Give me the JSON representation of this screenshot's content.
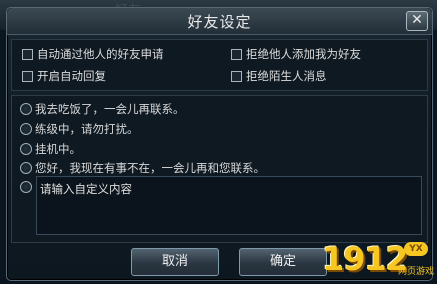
{
  "background": {
    "ghost_text": "好友"
  },
  "dialog": {
    "title": "好友设定",
    "close_label": "✕"
  },
  "options": [
    {
      "label": "自动通过他人的好友申请",
      "checked": false
    },
    {
      "label": "拒绝他人添加我为好友",
      "checked": false
    },
    {
      "label": "开启自动回复",
      "checked": false
    },
    {
      "label": "拒绝陌生人消息",
      "checked": false
    }
  ],
  "auto_replies": [
    {
      "label": "我去吃饭了，一会儿再联系。",
      "selected": false
    },
    {
      "label": "练级中，请勿打扰。",
      "selected": false
    },
    {
      "label": "挂机中。",
      "selected": false
    },
    {
      "label": "您好，我现在有事不在，一会儿再和您联系。",
      "selected": false
    }
  ],
  "custom_reply": {
    "placeholder": "请输入自定义内容",
    "value": "",
    "selected": false
  },
  "buttons": {
    "cancel": "取消",
    "confirm": "确定"
  },
  "watermark": {
    "number": "1912",
    "badge": "YX",
    "subtitle": "网页游戏"
  },
  "colors": {
    "dialog_bg": "#101b25",
    "title_text": "#e9e9e9",
    "watermark": "#f6c623"
  }
}
